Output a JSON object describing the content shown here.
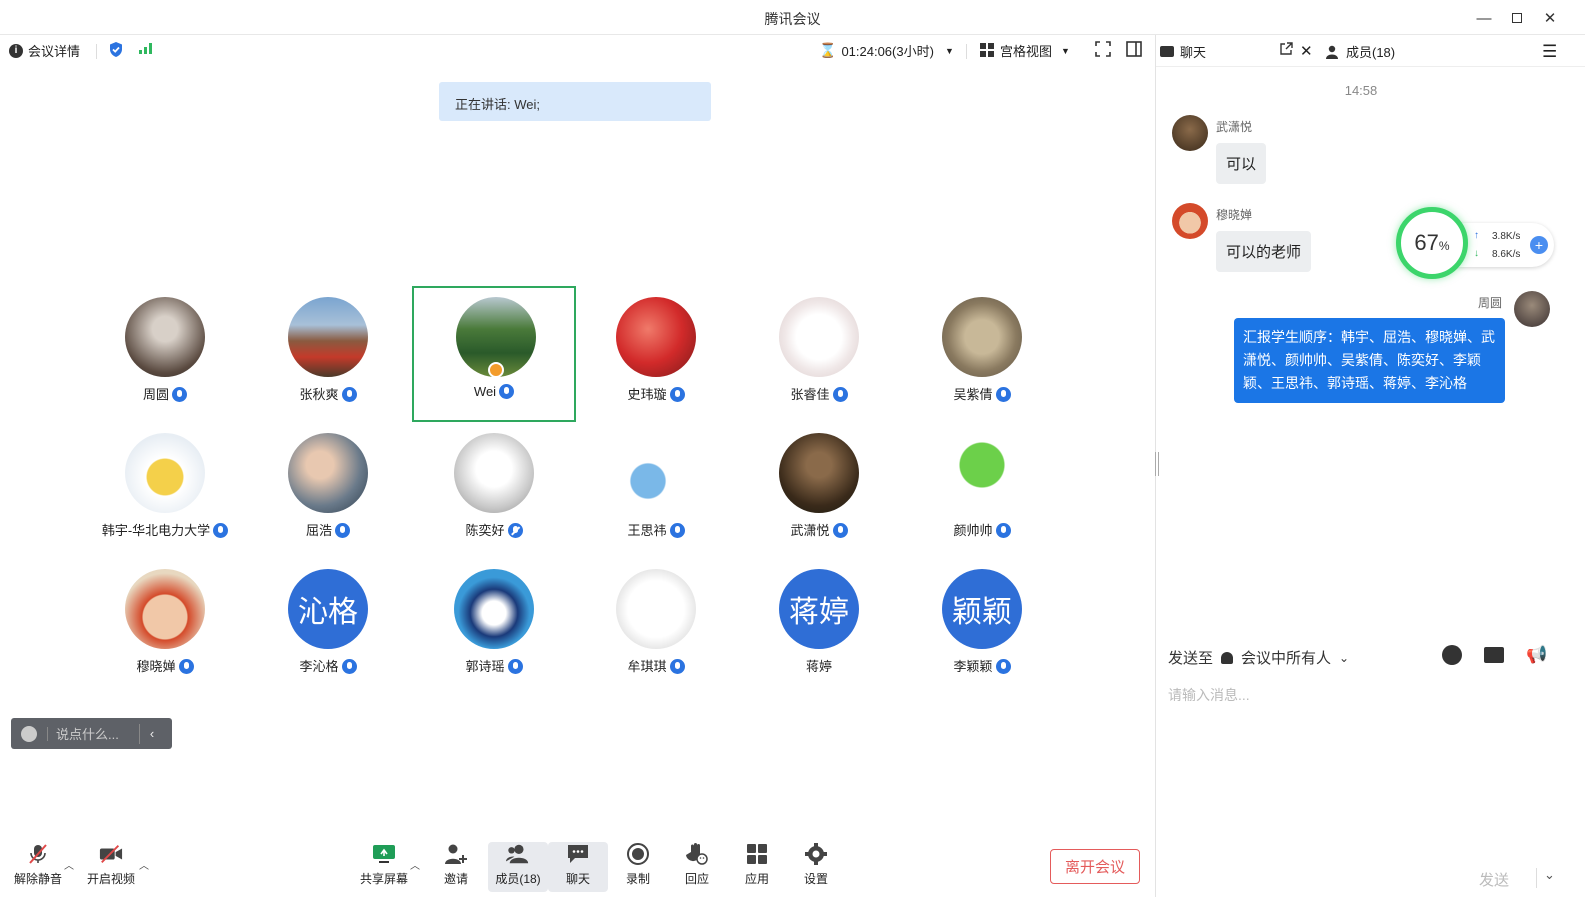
{
  "window": {
    "title": "腾讯会议"
  },
  "toolbar": {
    "meeting_details": "会议详情",
    "timer": "01:24:06(3小时)",
    "view_mode": "宫格视图"
  },
  "speaking": {
    "label": "正在讲话: Wei;"
  },
  "participants": [
    {
      "name": "周圆",
      "mic": "on",
      "avatar": "photo-portrait-bw"
    },
    {
      "name": "张秋爽",
      "mic": "on",
      "avatar": "photo-red-dress"
    },
    {
      "name": "Wei",
      "mic": "on",
      "avatar": "photo-garden",
      "active": true,
      "host": true
    },
    {
      "name": "史玮璇",
      "mic": "on",
      "avatar": "photo-red-flowers"
    },
    {
      "name": "张睿佳",
      "mic": "on",
      "avatar": "cartoon-girl"
    },
    {
      "name": "吴紫倩",
      "mic": "on",
      "avatar": "photo-cat"
    },
    {
      "name": "韩宇-华北电力大学",
      "mic": "on",
      "avatar": "cartoon-duck"
    },
    {
      "name": "屈浩",
      "mic": "on",
      "avatar": "photo-man"
    },
    {
      "name": "陈奕好",
      "mic": "off",
      "avatar": "photo-white-bird"
    },
    {
      "name": "王思祎",
      "mic": "on",
      "avatar": "cartoon-flower"
    },
    {
      "name": "武潇悦",
      "mic": "on",
      "avatar": "photo-woman-dark"
    },
    {
      "name": "颜帅帅",
      "mic": "on",
      "avatar": "cartoon-frog"
    },
    {
      "name": "穆晓婵",
      "mic": "on",
      "avatar": "photo-child"
    },
    {
      "name": "李沁格",
      "mic": "on",
      "avatar_text": "沁格"
    },
    {
      "name": "郭诗瑶",
      "mic": "on",
      "avatar": "cartoon-boy-cap"
    },
    {
      "name": "牟琪琪",
      "mic": "on",
      "avatar": "cartoon-headphones"
    },
    {
      "name": "蒋婷",
      "mic": "none",
      "avatar_text": "蒋婷"
    },
    {
      "name": "李颖颖",
      "mic": "on",
      "avatar_text": "颖颖"
    }
  ],
  "saybox": {
    "placeholder": "说点什么..."
  },
  "bottombar": {
    "unmute": "解除静音",
    "start_video": "开启视频",
    "share_screen": "共享屏幕",
    "invite": "邀请",
    "members": "成员(18)",
    "chat": "聊天",
    "record": "录制",
    "react": "回应",
    "apps": "应用",
    "settings": "设置",
    "leave": "离开会议"
  },
  "chat_panel": {
    "tab_chat": "聊天",
    "tab_members": "成员(18)",
    "time": "14:58",
    "messages": [
      {
        "sender": "武潇悦",
        "text": "可以"
      },
      {
        "sender": "穆晓婵",
        "text": "可以的老师"
      },
      {
        "sender": "周圆",
        "text": "汇报学生顺序：韩宇、屈浩、穆晓婵、武潇悦、颜帅帅、吴紫倩、陈奕好、李颖颖、王思祎、郭诗瑶、蒋婷、李沁格"
      }
    ],
    "send_to_label": "发送至",
    "send_to_target": "会议中所有人",
    "input_placeholder": "请输入消息...",
    "send_button": "发送"
  },
  "network": {
    "percent": "67",
    "percent_sign": "%",
    "up": "3.8K/s",
    "down": "8.6K/s"
  },
  "colors": {
    "accent": "#2b73e0",
    "active_border": "#2ea85e",
    "leave": "#e45b5b",
    "bubble_self": "#1b76e6"
  }
}
